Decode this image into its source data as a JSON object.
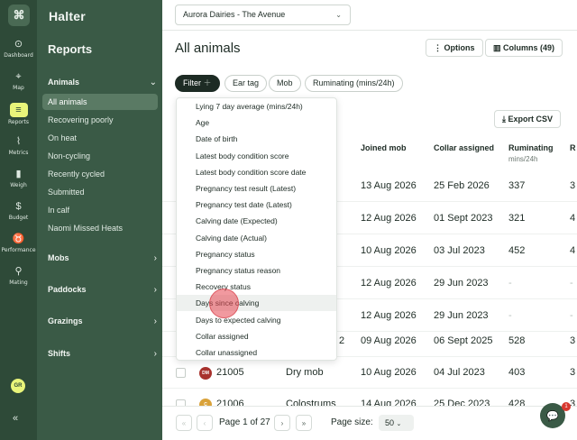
{
  "rail": {
    "items": [
      {
        "icon": "⊙",
        "label": "Dashboard"
      },
      {
        "icon": "⌖",
        "label": "Map"
      },
      {
        "icon": "≡",
        "label": "Reports"
      },
      {
        "icon": "⌇",
        "label": "Metrics"
      },
      {
        "icon": "▮",
        "label": "Weigh"
      },
      {
        "icon": "$",
        "label": "Budget"
      },
      {
        "icon": "♉",
        "label": "Performance"
      },
      {
        "icon": "⚲",
        "label": "Mating"
      }
    ],
    "avatar": "GR",
    "collapse": "«"
  },
  "sidebar": {
    "brand": "Halter",
    "title": "Reports",
    "animals_group": "Animals",
    "animals_items": [
      "All animals",
      "Recovering poorly",
      "On heat",
      "Non-cycling",
      "Recently cycled",
      "Submitted",
      "In calf",
      "Naomi Missed Heats"
    ],
    "groups": [
      "Mobs",
      "Paddocks",
      "Grazings",
      "Shifts"
    ]
  },
  "topbar": {
    "farm": "Aurora Dairies - The Avenue"
  },
  "page": {
    "title": "All animals"
  },
  "toolbar": {
    "options": "Options",
    "columns": "Columns (49)",
    "export": "Export CSV"
  },
  "filters": {
    "filter": "Filter",
    "pills": [
      "Ear tag",
      "Mob",
      "Ruminating (mins/24h)"
    ]
  },
  "columns": {
    "joined": "Joined mob",
    "collar": "Collar assigned",
    "ruminating": "Ruminating",
    "ruminating_unit": "mins/24h",
    "extra": "R"
  },
  "rows": [
    {
      "badge": "",
      "badge_color": "#7a8a80",
      "tag": "",
      "mob": "",
      "joined": "13 Aug 2026",
      "collar": "25 Feb 2026",
      "rum": "337",
      "extra": "3"
    },
    {
      "badge": "",
      "badge_color": "#7a8a80",
      "tag": "",
      "mob": "",
      "joined": "12 Aug 2026",
      "collar": "01 Sept 2023",
      "rum": "321",
      "extra": "4"
    },
    {
      "badge": "",
      "badge_color": "#7a8a80",
      "tag": "",
      "mob": "",
      "joined": "10 Aug 2026",
      "collar": "03 Jul 2023",
      "rum": "452",
      "extra": "4"
    },
    {
      "badge": "",
      "badge_color": "#7a8a80",
      "tag": "",
      "mob": "",
      "joined": "12 Aug 2026",
      "collar": "29 Jun 2023",
      "rum": "-",
      "extra": "-"
    },
    {
      "badge": "",
      "badge_color": "#7a8a80",
      "tag": "",
      "mob": "",
      "joined": "12 Aug 2026",
      "collar": "29 Jun 2023",
      "rum": "-",
      "extra": "-"
    },
    {
      "badge": "",
      "badge_color": "#7a8a80",
      "tag": "",
      "mob": "2",
      "joined": "09 Aug 2026",
      "collar": "06 Sept 2025",
      "rum": "528",
      "extra": "3"
    },
    {
      "badge": "DM",
      "badge_color": "#a8322d",
      "tag": "21005",
      "mob": "Dry mob",
      "joined": "10 Aug 2026",
      "collar": "04 Jul 2023",
      "rum": "403",
      "extra": "3"
    },
    {
      "badge": "C",
      "badge_color": "#d9a23a",
      "tag": "21006",
      "mob": "Colostrums",
      "joined": "14 Aug 2026",
      "collar": "25 Dec 2023",
      "rum": "428",
      "extra": "3"
    }
  ],
  "footer": {
    "first": "«",
    "prev": "‹",
    "page": "Page 1 of 27",
    "next": "›",
    "last": "»",
    "size_label": "Page size:",
    "size": "50"
  },
  "chat": {
    "badge": "1"
  },
  "dropdown": {
    "items": [
      "Lying 7 day average (mins/24h)",
      "Age",
      "Date of birth",
      "Latest body condition score",
      "Latest body condition score date",
      "Pregnancy test result (Latest)",
      "Pregnancy test date (Latest)",
      "Calving date (Expected)",
      "Calving date (Actual)",
      "Pregnancy status",
      "Pregnancy status reason",
      "Recovery status",
      "Days since calving",
      "Days to expected calving",
      "Collar assigned",
      "Collar unassigned"
    ],
    "hovered_index": 12
  }
}
